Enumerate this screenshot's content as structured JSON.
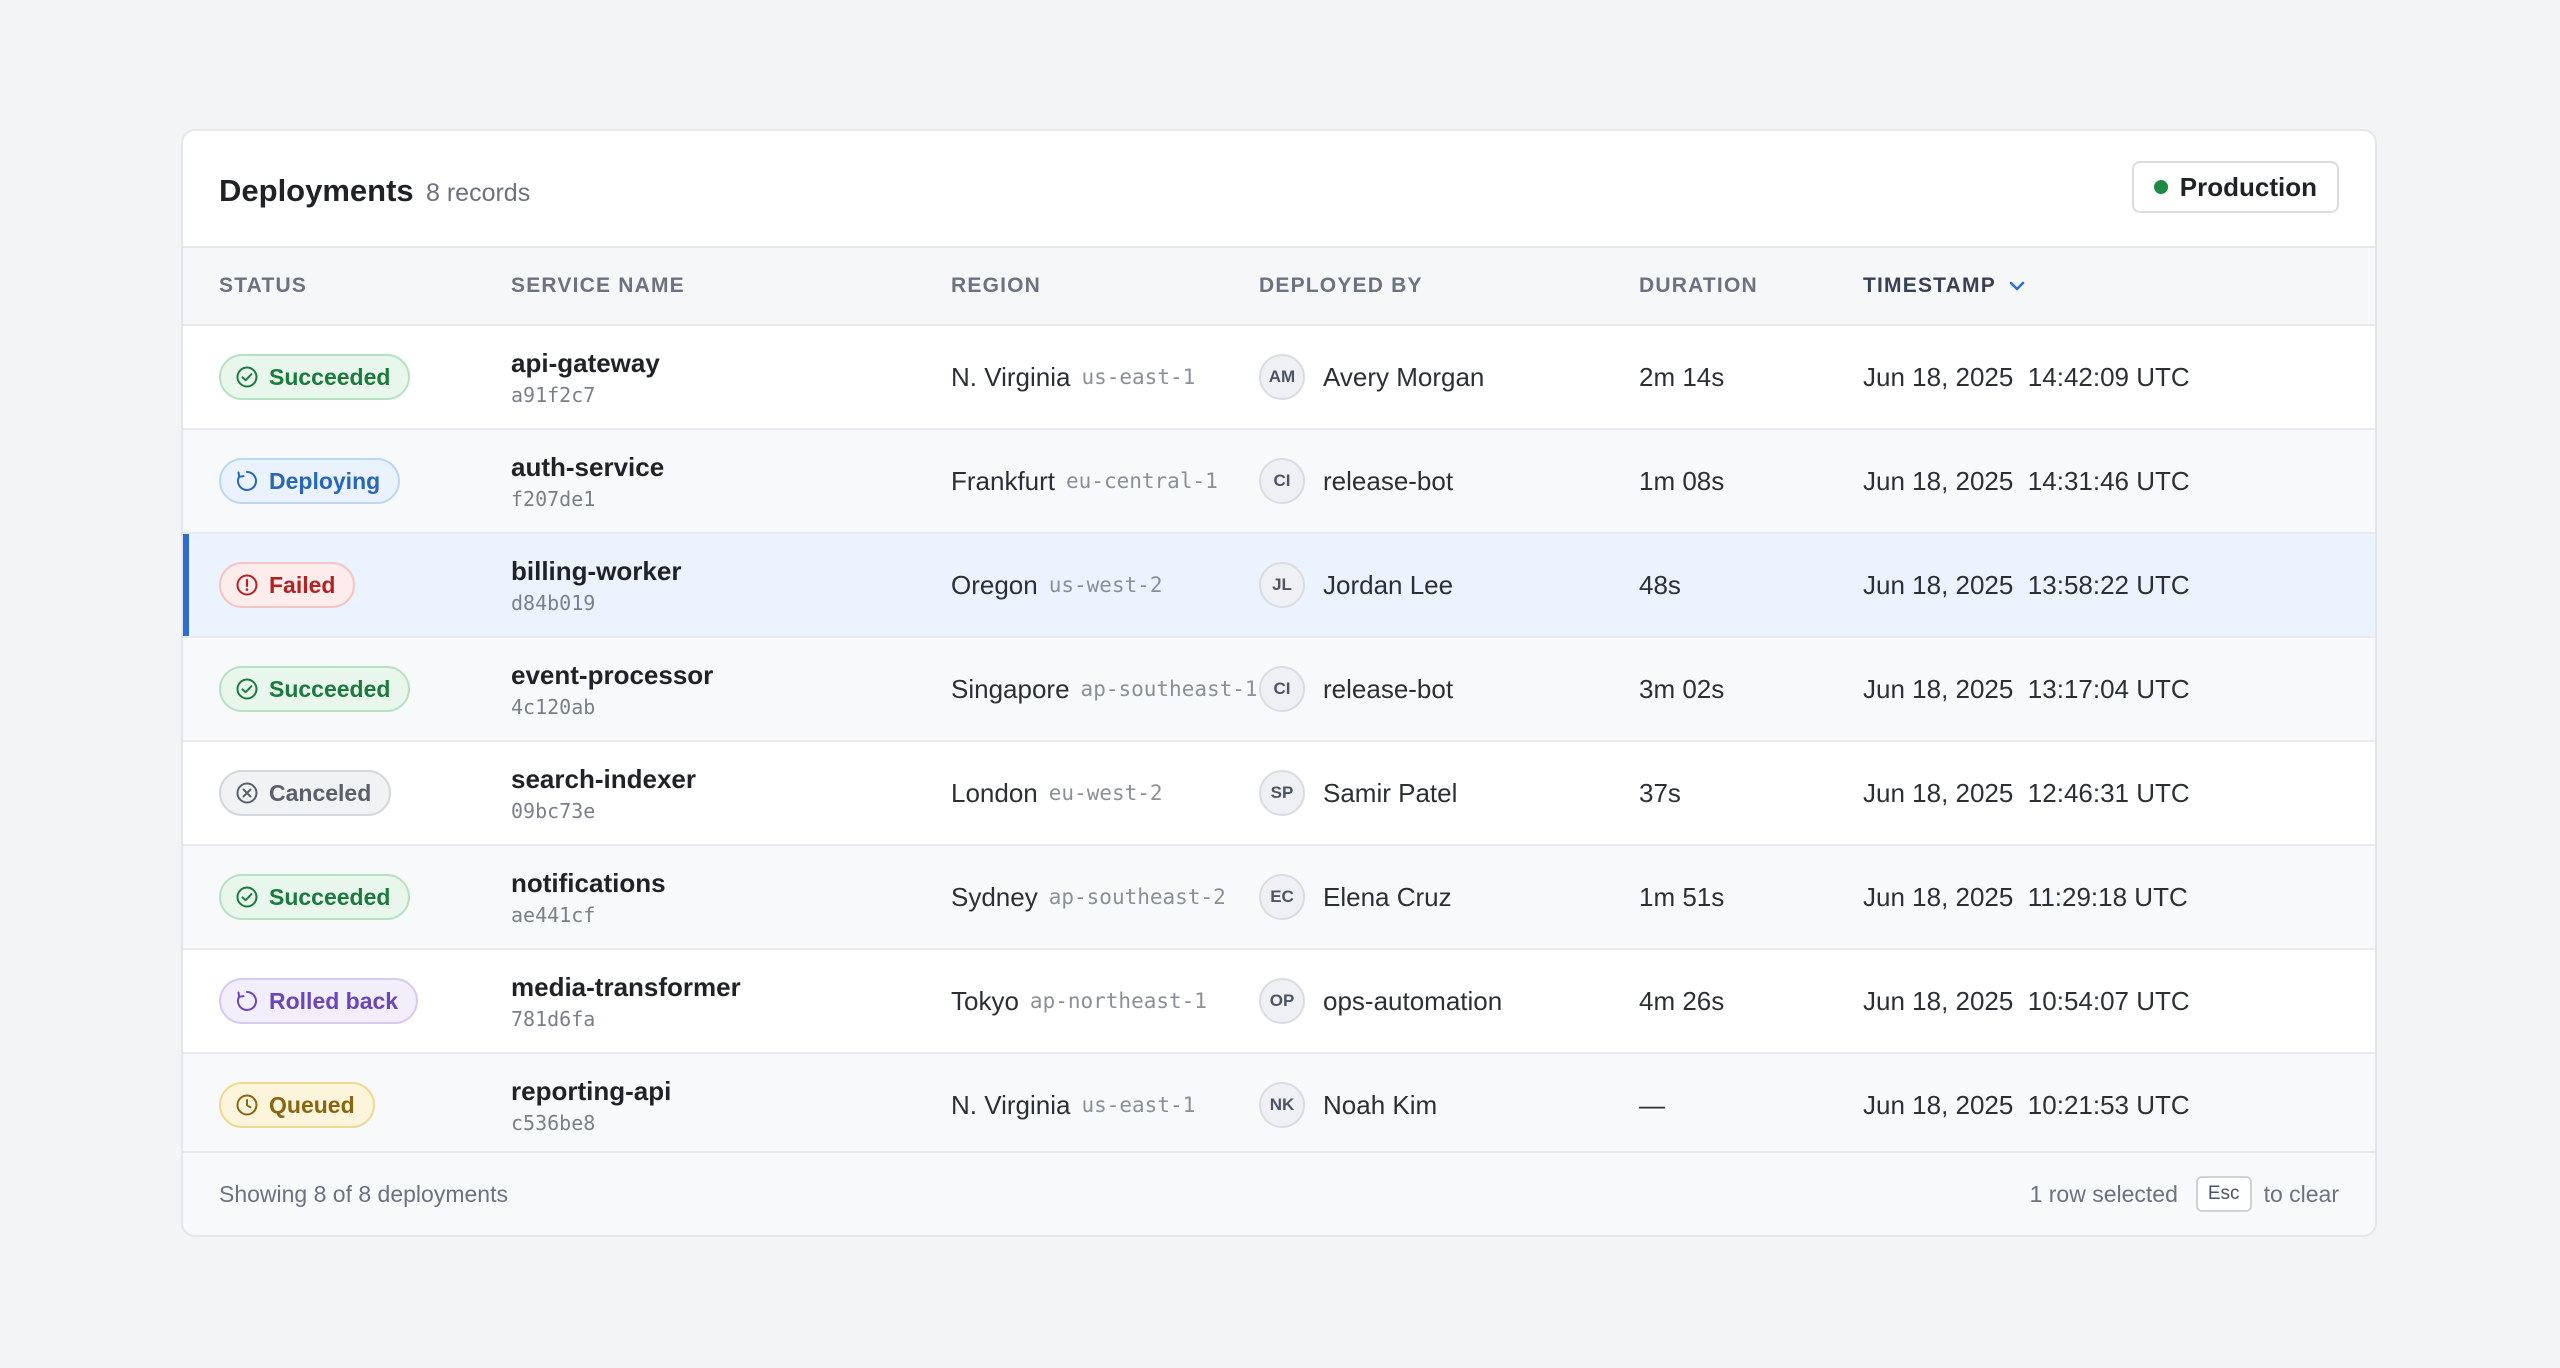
{
  "header": {
    "title": "Deployments",
    "record_count": "8 records",
    "environment": {
      "label": "Production",
      "dot_color": "#1f8a45"
    }
  },
  "columns": {
    "status": "Status",
    "service_name": "Service name",
    "region": "Region",
    "deployed_by": "Deployed by",
    "duration": "Duration",
    "timestamp": "Timestamp",
    "sorted_column": "timestamp",
    "sort_icon": "chevron-down-icon"
  },
  "rows": [
    {
      "status": "Succeeded",
      "status_kind": "succeeded",
      "status_icon": "check-circle-icon",
      "service": "api-gateway",
      "hash": "a91f2c7",
      "region": "N. Virginia",
      "region_code": "us-east-1",
      "initials": "AM",
      "deployer": "Avery Morgan",
      "duration": "2m 14s",
      "timestamp": "Jun 18, 2025  14:42:09 UTC",
      "selected": false
    },
    {
      "status": "Deploying",
      "status_kind": "deploying",
      "status_icon": "refresh-icon",
      "service": "auth-service",
      "hash": "f207de1",
      "region": "Frankfurt",
      "region_code": "eu-central-1",
      "initials": "CI",
      "deployer": "release-bot",
      "duration": "1m 08s",
      "timestamp": "Jun 18, 2025  14:31:46 UTC",
      "selected": false
    },
    {
      "status": "Failed",
      "status_kind": "failed",
      "status_icon": "alert-circle-icon",
      "service": "billing-worker",
      "hash": "d84b019",
      "region": "Oregon",
      "region_code": "us-west-2",
      "initials": "JL",
      "deployer": "Jordan Lee",
      "duration": "48s",
      "timestamp": "Jun 18, 2025  13:58:22 UTC",
      "selected": true
    },
    {
      "status": "Succeeded",
      "status_kind": "succeeded",
      "status_icon": "check-circle-icon",
      "service": "event-processor",
      "hash": "4c120ab",
      "region": "Singapore",
      "region_code": "ap-southeast-1",
      "initials": "CI",
      "deployer": "release-bot",
      "duration": "3m 02s",
      "timestamp": "Jun 18, 2025  13:17:04 UTC",
      "selected": false
    },
    {
      "status": "Canceled",
      "status_kind": "canceled",
      "status_icon": "x-circle-icon",
      "service": "search-indexer",
      "hash": "09bc73e",
      "region": "London",
      "region_code": "eu-west-2",
      "initials": "SP",
      "deployer": "Samir Patel",
      "duration": "37s",
      "timestamp": "Jun 18, 2025  12:46:31 UTC",
      "selected": false
    },
    {
      "status": "Succeeded",
      "status_kind": "succeeded",
      "status_icon": "check-circle-icon",
      "service": "notifications",
      "hash": "ae441cf",
      "region": "Sydney",
      "region_code": "ap-southeast-2",
      "initials": "EC",
      "deployer": "Elena Cruz",
      "duration": "1m 51s",
      "timestamp": "Jun 18, 2025  11:29:18 UTC",
      "selected": false
    },
    {
      "status": "Rolled back",
      "status_kind": "rolledback",
      "status_icon": "rotate-ccw-icon",
      "service": "media-transformer",
      "hash": "781d6fa",
      "region": "Tokyo",
      "region_code": "ap-northeast-1",
      "initials": "OP",
      "deployer": "ops-automation",
      "duration": "4m 26s",
      "timestamp": "Jun 18, 2025  10:54:07 UTC",
      "selected": false
    },
    {
      "status": "Queued",
      "status_kind": "queued",
      "status_icon": "clock-icon",
      "service": "reporting-api",
      "hash": "c536be8",
      "region": "N. Virginia",
      "region_code": "us-east-1",
      "initials": "NK",
      "deployer": "Noah Kim",
      "duration": "—",
      "timestamp": "Jun 18, 2025  10:21:53 UTC",
      "selected": false
    }
  ],
  "footer": {
    "showing": "Showing 8 of 8 deployments",
    "selection": "1 row selected",
    "key": "Esc",
    "hint": "to clear"
  },
  "colors": {
    "selected_accent": "#2e6ad0",
    "succeeded": "#1b7a3e",
    "deploying": "#2766b8",
    "failed": "#b42323",
    "canceled": "#59606b",
    "rolled_back": "#6b46b8",
    "queued": "#8a6410"
  }
}
